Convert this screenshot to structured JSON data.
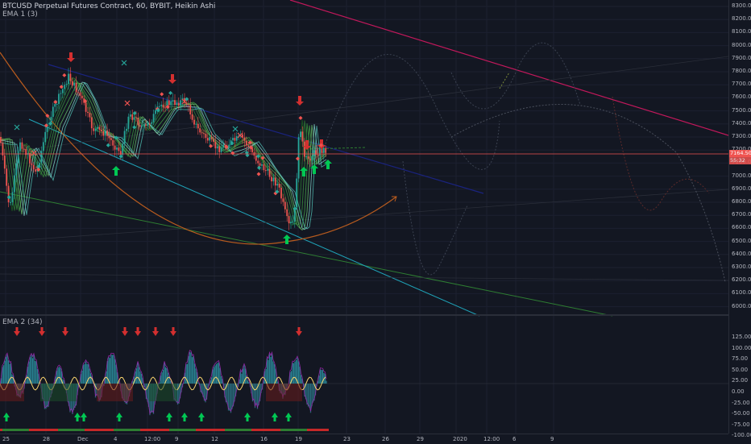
{
  "header": {
    "title": "BTCUSD Perpetual Futures Contract, 60, BYBIT, Heikin Ashi",
    "indicator1": "EMA 1 (3)",
    "indicator2": "EMA 2 (34)"
  },
  "price_axis": {
    "labels": [
      "8300.00",
      "8200.00",
      "8100.00",
      "8000.00",
      "7900.00",
      "7800.00",
      "7700.00",
      "7600.00",
      "7500.00",
      "7400.00",
      "7300.00",
      "7200.00",
      "7100.00",
      "7000.00",
      "6900.00",
      "6800.00",
      "6700.00",
      "6600.00",
      "6500.00",
      "6400.00",
      "6300.00",
      "6200.00",
      "6100.00",
      "6000.00"
    ],
    "current_price": "7164.50",
    "countdown": "55:32"
  },
  "osc_axis": {
    "labels": [
      "125.00",
      "100.00",
      "75.00",
      "50.00",
      "25.00",
      "0.00",
      "-25.00",
      "-50.00",
      "-75.00",
      "-100.00"
    ]
  },
  "time_axis": {
    "labels": [
      "25",
      "28",
      "Dec",
      "4",
      "12:00",
      "9",
      "12",
      "16",
      "19",
      "23",
      "26",
      "29",
      "2020",
      "12:00",
      "6",
      "9"
    ]
  },
  "colors": {
    "background": "#131722",
    "bull": "#26a69a",
    "bear": "#ef5350",
    "price_line": "#ef5350",
    "trend_red": "#c2185b",
    "trend_blue": "#1e2a7a",
    "trend_cyan": "#00bcd4",
    "trend_green": "#2e7d32",
    "arc_orange": "#b85b1e"
  }
}
